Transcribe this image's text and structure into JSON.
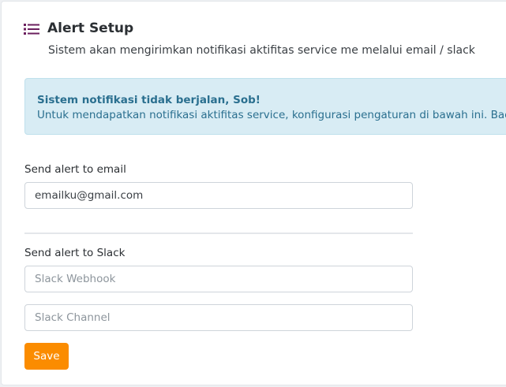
{
  "header": {
    "title": "Alert Setup",
    "subtitle": "Sistem akan mengirimkan notifikasi aktifitas service me melalui email / slack",
    "icon": "list-icon",
    "icon_color": "#6b1f5e"
  },
  "alert": {
    "title": "Sistem notifikasi tidak berjalan, Sob!",
    "body": "Untuk mendapatkan notifikasi aktifitas service, konfigurasi pengaturan di bawah ini. Baca P"
  },
  "email": {
    "label": "Send alert to email",
    "value": "emailku@gmail.com"
  },
  "slack": {
    "label": "Send alert to Slack",
    "webhook_placeholder": "Slack Webhook",
    "channel_placeholder": "Slack Channel"
  },
  "actions": {
    "save_label": "Save",
    "save_color": "#fb8c00"
  }
}
